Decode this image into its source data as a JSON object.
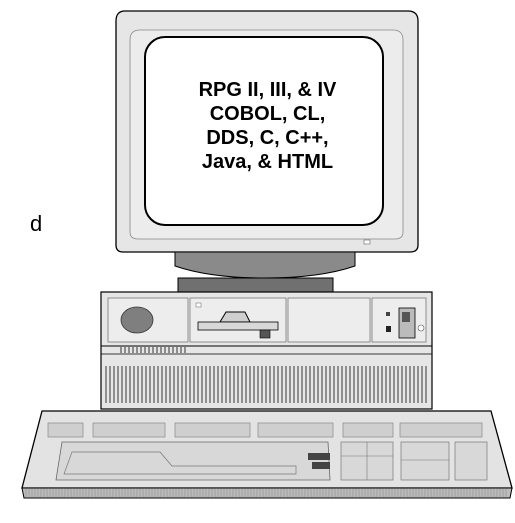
{
  "screen": {
    "lines": [
      "RPG II, III, & IV",
      "COBOL, CL,",
      "DDS, C, C++,",
      "Java, & HTML"
    ]
  },
  "side_text": "d",
  "colors": {
    "monitor_body": "#e6e6e6",
    "screen_face": "#ffffff",
    "outline": "#000000",
    "shadow": "#7a7a7a",
    "keyboard": "#e3e3e3",
    "key_dark": "#444444"
  },
  "icons": [
    "computer-monitor-icon",
    "system-unit-icon",
    "floppy-drive-icon",
    "keyboard-icon"
  ]
}
